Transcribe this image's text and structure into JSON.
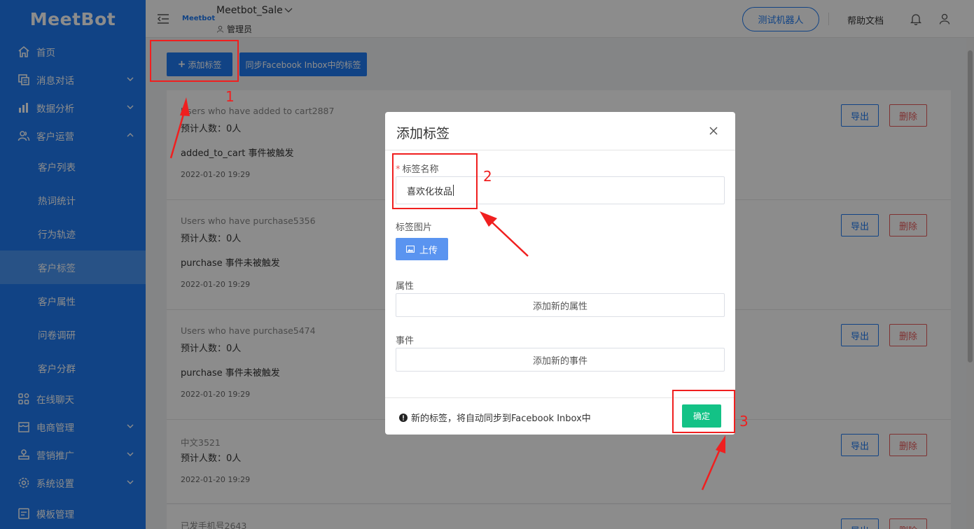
{
  "sidebar": {
    "logo": "MeetBot",
    "items": [
      {
        "label": "首页",
        "icon": "home-icon"
      },
      {
        "label": "消息对话",
        "icon": "message-icon",
        "expand": "down"
      },
      {
        "label": "数据分析",
        "icon": "chart-icon",
        "expand": "down"
      },
      {
        "label": "客户运营",
        "icon": "users-icon",
        "expand": "up"
      }
    ],
    "sub_items": [
      "客户列表",
      "热词统计",
      "行为轨迹",
      "客户标签",
      "客户属性",
      "问卷调研",
      "客户分群"
    ],
    "active_sub": "客户标签",
    "items_bottom": [
      {
        "label": "在线聊天",
        "icon": "apps-icon"
      },
      {
        "label": "电商管理",
        "icon": "store-icon",
        "expand": "down"
      },
      {
        "label": "营销推广",
        "icon": "marketing-icon",
        "expand": "down"
      },
      {
        "label": "系统设置",
        "icon": "gear-icon",
        "expand": "down"
      },
      {
        "label": "模板管理",
        "icon": "template-icon"
      }
    ]
  },
  "header": {
    "mini_logo": "Meetbot",
    "shop_name": "Meetbot_Sale",
    "role": "管理员",
    "test_robot": "测试机器人",
    "help_docs": "帮助文档"
  },
  "toolbar": {
    "add_tag": "添加标签",
    "sync_tags": "同步Facebook Inbox中的标签"
  },
  "cards": [
    {
      "title": "Users who have added to cart2887",
      "count": "预计人数：0人",
      "desc": "added_to_cart 事件被触发",
      "date": "2022-01-20 19:29",
      "export": "导出",
      "delete": "删除"
    },
    {
      "title": "Users who have purchase5356",
      "count": "预计人数：0人",
      "desc": "purchase 事件未被触发",
      "date": "2022-01-20 19:29",
      "export": "导出",
      "delete": "删除"
    },
    {
      "title": "Users who have purchase5474",
      "count": "预计人数：0人",
      "desc": "purchase 事件未被触发",
      "date": "2022-01-20 19:29",
      "export": "导出",
      "delete": "删除"
    },
    {
      "title": "中文3521",
      "count": "预计人数：0人",
      "desc": "",
      "date": "2022-01-20 19:29",
      "export": "导出",
      "delete": "删除"
    },
    {
      "title": "已发手机号2643",
      "count": "",
      "desc": "",
      "date": "",
      "export": "导出",
      "delete": "删除"
    }
  ],
  "modal": {
    "title": "添加标签",
    "name_label": "标签名称",
    "name_required": "*",
    "name_value": "喜欢化妆品",
    "image_label": "标签图片",
    "upload": "上传",
    "attr_label": "属性",
    "add_attr": "添加新的属性",
    "event_label": "事件",
    "add_event": "添加新的事件",
    "notice": "新的标签，将自动同步到Facebook Inbox中",
    "confirm": "确定"
  },
  "annotations": {
    "n1": "1",
    "n2": "2",
    "n3": "3"
  },
  "colors": {
    "primary": "#1f7bf2",
    "danger": "#e85a5a",
    "confirm": "#13c286",
    "annotation": "#f01f1f"
  }
}
